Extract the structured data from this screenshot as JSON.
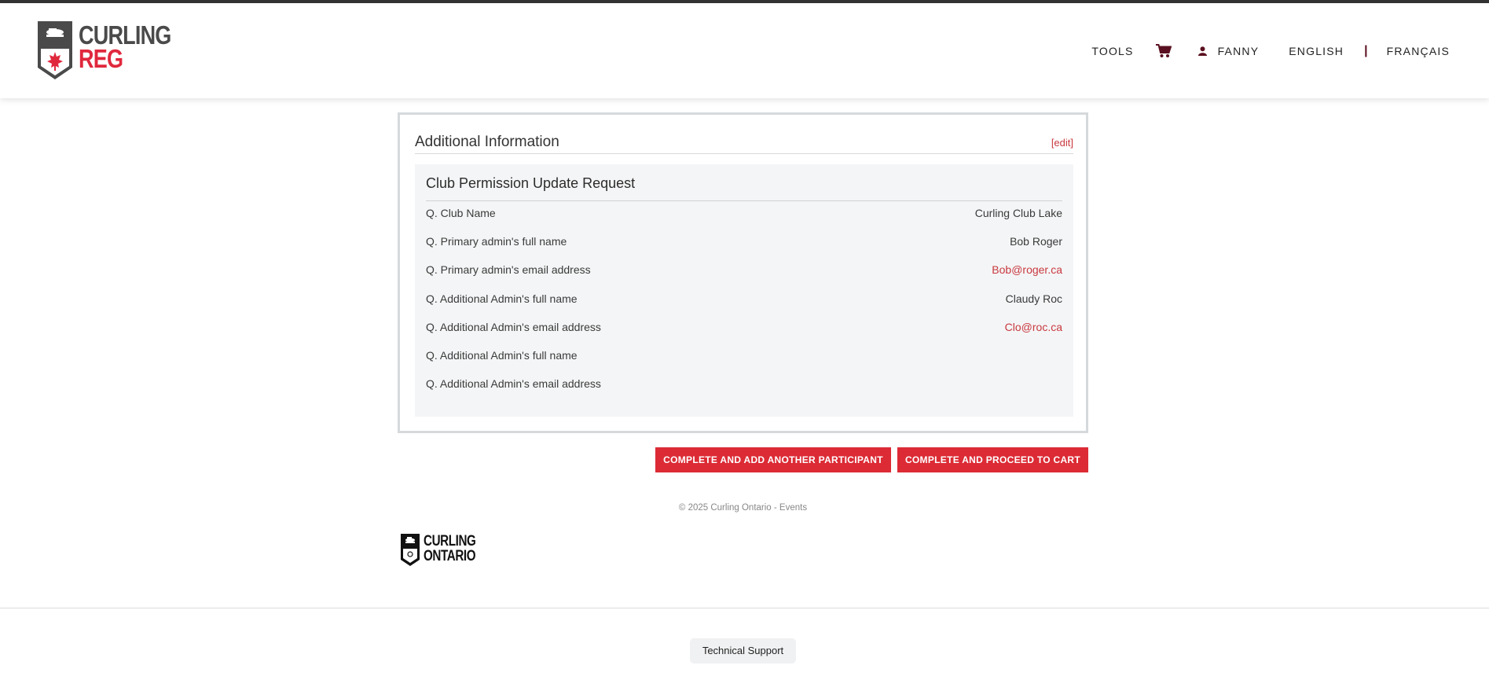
{
  "brand": {
    "line1": "CURLING",
    "line2": "REG",
    "accent_color": "#e0283d"
  },
  "nav": {
    "tools": "TOOLS",
    "cart_icon": "cart-icon",
    "user_icon": "user-icon",
    "user": "FANNY",
    "lang_en": "ENGLISH",
    "separator": "|",
    "lang_fr": "FRANÇAIS"
  },
  "panel": {
    "title": "Additional Information",
    "edit": "[edit]",
    "section_title": "Club Permission Update Request",
    "rows": [
      {
        "q": "Q. Club Name",
        "a": "Curling Club Lake",
        "email": false
      },
      {
        "q": "Q. Primary admin's full name",
        "a": "Bob Roger",
        "email": false
      },
      {
        "q": "Q. Primary admin's email address",
        "a": "Bob@roger.ca",
        "email": true
      },
      {
        "q": "Q. Additional Admin's full name",
        "a": "Claudy Roc",
        "email": false
      },
      {
        "q": "Q. Additional Admin's email address",
        "a": "Clo@roc.ca",
        "email": true
      },
      {
        "q": "Q. Additional Admin's full name",
        "a": "",
        "email": false
      },
      {
        "q": "Q. Additional Admin's email address",
        "a": "",
        "email": false
      }
    ]
  },
  "actions": {
    "add_participant": "COMPLETE AND ADD ANOTHER PARTICIPANT",
    "proceed_cart": "COMPLETE AND PROCEED TO CART",
    "button_color": "#dc2b35"
  },
  "footer": {
    "copyright": "© 2025 Curling Ontario - Events",
    "ontario_line1": "CURLING",
    "ontario_line2": "ONTARIO",
    "support": "Technical Support"
  }
}
